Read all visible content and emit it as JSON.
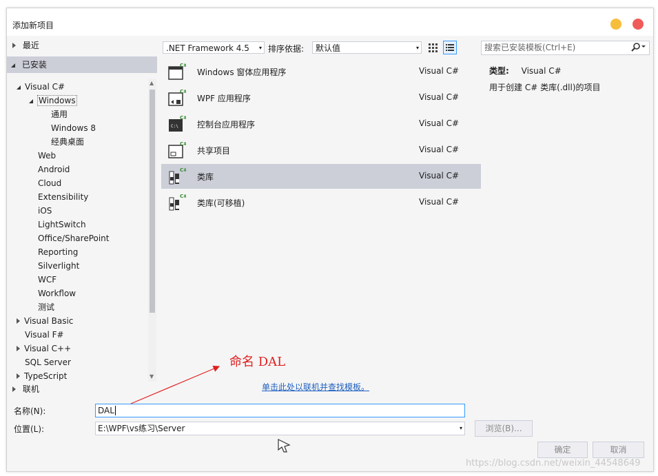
{
  "window": {
    "title": "添加新项目"
  },
  "left_panel": {
    "recent": "最近",
    "installed": "已安装",
    "online": "联机",
    "tree": [
      "Visual C#",
      "Windows",
      "通用",
      "Windows 8",
      "经典桌面",
      "Web",
      "Android",
      "Cloud",
      "Extensibility",
      "iOS",
      "LightSwitch",
      "Office/SharePoint",
      "Reporting",
      "Silverlight",
      "WCF",
      "Workflow",
      "测试",
      "Visual Basic",
      "Visual F#",
      "Visual C++",
      "SQL Server",
      "TypeScript"
    ]
  },
  "toolbar": {
    "framework": ".NET Framework 4.5",
    "sort_label": "排序依据:",
    "sort_value": "默认值",
    "search_placeholder": "搜索已安装模板(Ctrl+E)"
  },
  "templates": [
    {
      "name": "Windows 窗体应用程序",
      "lang": "Visual C#"
    },
    {
      "name": "WPF 应用程序",
      "lang": "Visual C#"
    },
    {
      "name": "控制台应用程序",
      "lang": "Visual C#"
    },
    {
      "name": "共享项目",
      "lang": "Visual C#"
    },
    {
      "name": "类库",
      "lang": "Visual C#"
    },
    {
      "name": "类库(可移植)",
      "lang": "Visual C#"
    }
  ],
  "details": {
    "type_label": "类型:",
    "type_value": "Visual C#",
    "description": "用于创建 C# 类库(.dll)的项目"
  },
  "online_link": "单击此处以联机并查找模板。",
  "form": {
    "name_label": "名称(N):",
    "name_value": "DAL",
    "location_label": "位置(L):",
    "location_value": "E:\\WPF\\vs练习\\Server",
    "browse_label": "浏览(B)...",
    "ok_label": "确定",
    "cancel_label": "取消"
  },
  "annotation": "命名 DAL",
  "watermark": "https://blog.csdn.net/weixin_44548649",
  "colors": {
    "selection": "#ccced8",
    "accent": "#007acc",
    "annotation": "#e02020"
  }
}
